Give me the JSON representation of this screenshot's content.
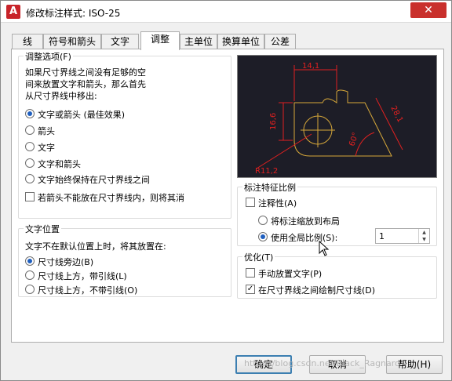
{
  "window": {
    "title": "修改标注样式: ISO-25",
    "close": "✕"
  },
  "tabs": [
    {
      "label": "线"
    },
    {
      "label": "符号和箭头"
    },
    {
      "label": "文字"
    },
    {
      "label": "调整"
    },
    {
      "label": "主单位"
    },
    {
      "label": "换算单位"
    },
    {
      "label": "公差"
    }
  ],
  "active_tab": "调整",
  "adjust_options": {
    "title": "调整选项(F)",
    "description": [
      "如果尺寸界线之间没有足够的空",
      "间来放置文字和箭头，那么首先",
      "从尺寸界线中移出:"
    ],
    "radios": [
      {
        "label": "文字或箭头 (最佳效果)",
        "selected": true
      },
      {
        "label": "箭头",
        "selected": false
      },
      {
        "label": "文字",
        "selected": false
      },
      {
        "label": "文字和箭头",
        "selected": false
      },
      {
        "label": "文字始终保持在尺寸界线之间",
        "selected": false
      }
    ],
    "suppress_checkbox": {
      "label": "若箭头不能放在尺寸界线内，则将其消",
      "checked": false
    }
  },
  "text_placement": {
    "title": "文字位置",
    "description": "文字不在默认位置上时，将其放置在:",
    "radios": [
      {
        "label": "尺寸线旁边(B)",
        "selected": true
      },
      {
        "label": "尺寸线上方，带引线(L)",
        "selected": false
      },
      {
        "label": "尺寸线上方，不带引线(O)",
        "selected": false
      }
    ]
  },
  "preview": {
    "labels": [
      "14,1",
      "16,6",
      "28,1",
      "60°",
      "R11,2"
    ],
    "colors": {
      "background": "#1d1d27",
      "dimension": "#e02020",
      "geometry": "#d7a83a"
    }
  },
  "scale": {
    "title": "标注特征比例",
    "annotative": {
      "label": "注释性(A)",
      "checked": false
    },
    "radios": [
      {
        "label": "将标注缩放到布局",
        "selected": false
      },
      {
        "label": "使用全局比例(S):",
        "selected": true
      }
    ],
    "global_scale_value": "1"
  },
  "fine_tuning": {
    "title": "优化(T)",
    "checkboxes": [
      {
        "label": "手动放置文字(P)",
        "checked": false
      },
      {
        "label": "在尺寸界线之间绘制尺寸线(D)",
        "checked": true
      }
    ]
  },
  "buttons": {
    "ok": "确定",
    "cancel": "取消",
    "help": "帮助(H)"
  },
  "watermark": "https://blog.csdn.net/Black_Ragnaro"
}
